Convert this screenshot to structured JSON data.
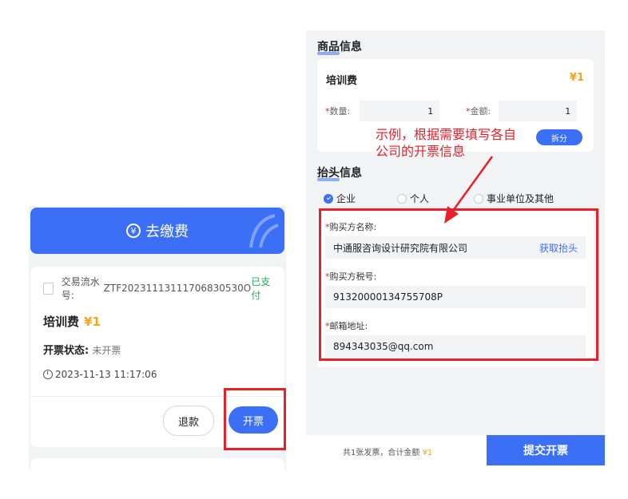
{
  "left": {
    "pay_banner": {
      "label": "去缴费",
      "icon": "yen-circle-icon"
    },
    "order": {
      "txn_label": "交易流水号:",
      "txn_id": "ZTF20231113111706830530O",
      "paid_status": "已支付",
      "item_name": "培训费",
      "item_price": "¥1",
      "invoice_status_label": "开票状态:",
      "invoice_status_value": "未开票",
      "time": "2023-11-13 11:17:06",
      "refund_button": "退款",
      "invoice_button": "开票"
    }
  },
  "right": {
    "goods_section_title": "商品信息",
    "goods": {
      "name": "培训费",
      "price": "¥1",
      "qty_label": "数量:",
      "qty_value": "1",
      "amount_label": "金额:",
      "amount_value": "1",
      "split_button": "拆分"
    },
    "header_section_title": "抬头信息",
    "buyer_types": [
      "企业",
      "个人",
      "事业单位及其他"
    ],
    "selected_buyer_type": "企业",
    "form": {
      "buyer_name_label": "购买方名称:",
      "buyer_name_value": "中通服咨询设计研究院有限公司",
      "get_header_link": "获取抬头",
      "tax_id_label": "购买方税号:",
      "tax_id_value": "91320000134755708P",
      "email_label": "邮箱地址:",
      "email_value": "894343035@qq.com"
    },
    "bottom": {
      "summary_prefix": "共1张发票，合计金额",
      "summary_amount": "¥1",
      "submit_button": "提交开票"
    }
  },
  "annotation": {
    "line1": "示例，根据需要填写各自",
    "line2": "公司的开票信息"
  },
  "colors": {
    "accent": "#3b6ff5",
    "highlight": "#e8202a",
    "price": "#f2a51a",
    "paid": "#1fae55"
  }
}
